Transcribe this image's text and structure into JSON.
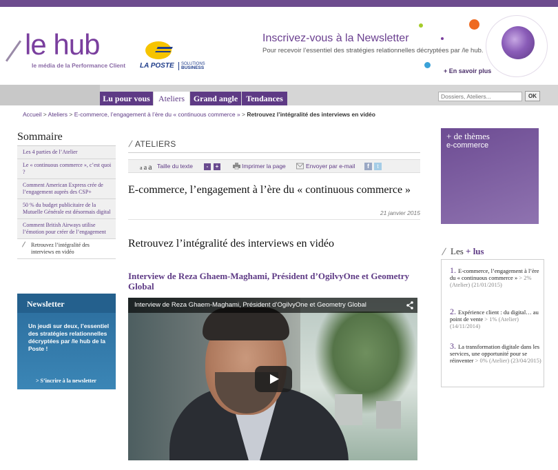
{
  "header": {
    "logo_word": "le hub",
    "logo_tagline": "le média de la Performance Client",
    "poste_name": "LA POSTE",
    "poste_solutions": "SOLUTIONS",
    "poste_business": "BUSINESS",
    "newsletter_title": "Inscrivez-vous à la Newsletter",
    "newsletter_sub": "Pour recevoir l’essentiel des stratégies relationnelles décryptées par /le hub.",
    "newsletter_more": "+ En savoir plus"
  },
  "nav": {
    "tabs": [
      {
        "label": "Lu pour vous"
      },
      {
        "label": "Ateliers"
      },
      {
        "label": "Grand angle"
      },
      {
        "label": "Tendances"
      }
    ],
    "search_placeholder": "Dossiers, Ateliers...",
    "search_ok": "OK"
  },
  "breadcrumb": {
    "home": "Accueil",
    "sep": ">",
    "section": "Ateliers",
    "parent": "E-commerce, l’engagement à l’ère du « continuous commerce »",
    "current": "Retrouvez l’intégralité des interviews en vidéo"
  },
  "sommaire": {
    "title": "Sommaire",
    "items": [
      {
        "label": "Les 4 parties de l’Atelier"
      },
      {
        "label": "Le « continuous commerce », c’est quoi ?"
      },
      {
        "label": "Comment American Express crée de l’engagement auprès des CSP+"
      },
      {
        "label": "50 % du budget publicitaire de la Mutuelle Générale est désormais digital"
      },
      {
        "label": "Comment British Airways utilise l’émotion pour créer de l’engagement"
      },
      {
        "label": "Retrouvez l’intégralité des interviews en vidéo"
      }
    ]
  },
  "newsletter_box": {
    "title": "Newsletter",
    "text": "Un jeudi sur deux, l’essentiel des stratégies relationnelles décryptées par /le hub de la Poste !",
    "link": "> S’incrire à la newsletter"
  },
  "article": {
    "section": "ATELIERS",
    "toolbar": {
      "size_glyphs": [
        "a",
        "a",
        "a"
      ],
      "text_size_label": "Taille du texte",
      "minus": "-",
      "plus": "+",
      "print_label": "Imprimer la page",
      "email_label": "Envoyer par e-mail",
      "fb": "f",
      "tw": "t"
    },
    "title": "E-commerce, l’engagement à l’ère du « continuous commerce »",
    "date": "21 janvier 2015",
    "subtitle": "Retrouvez l’intégralité des interviews en vidéo",
    "interview_title": "Interview de Reza Ghaem-Maghami, Président d’OgilvyOne et Geometry Global",
    "video_title": "Interview de Reza Ghaem-Maghami, Président d’OgilvyOne et Geometry Global"
  },
  "themes_box": {
    "title": "+ de thèmes",
    "sub": "e-commerce"
  },
  "plus_lus": {
    "head_prefix": "Les",
    "head_highlight": "+ lus",
    "items": [
      {
        "num": "1.",
        "title": "E-commerce, l’engagement à l’ère du « continuous commerce »",
        "meta": "> 2% (Atelier) (21/01/2015)"
      },
      {
        "num": "2.",
        "title": "Expérience client : du digital… au point de vente",
        "meta": "> 1% (Atelier) (14/11/2014)"
      },
      {
        "num": "3.",
        "title": "La transformation digitale dans les services, une opportunité pour se réinventer",
        "meta": "> 0% (Atelier) (23/04/2015)"
      }
    ]
  },
  "colors": {
    "brand_purple": "#5e3a85",
    "header_stripe": "#6d4c8e",
    "newsletter_blue": "#2f78a8",
    "poste_yellow": "#f6c400",
    "poste_blue": "#1f3d8a"
  }
}
